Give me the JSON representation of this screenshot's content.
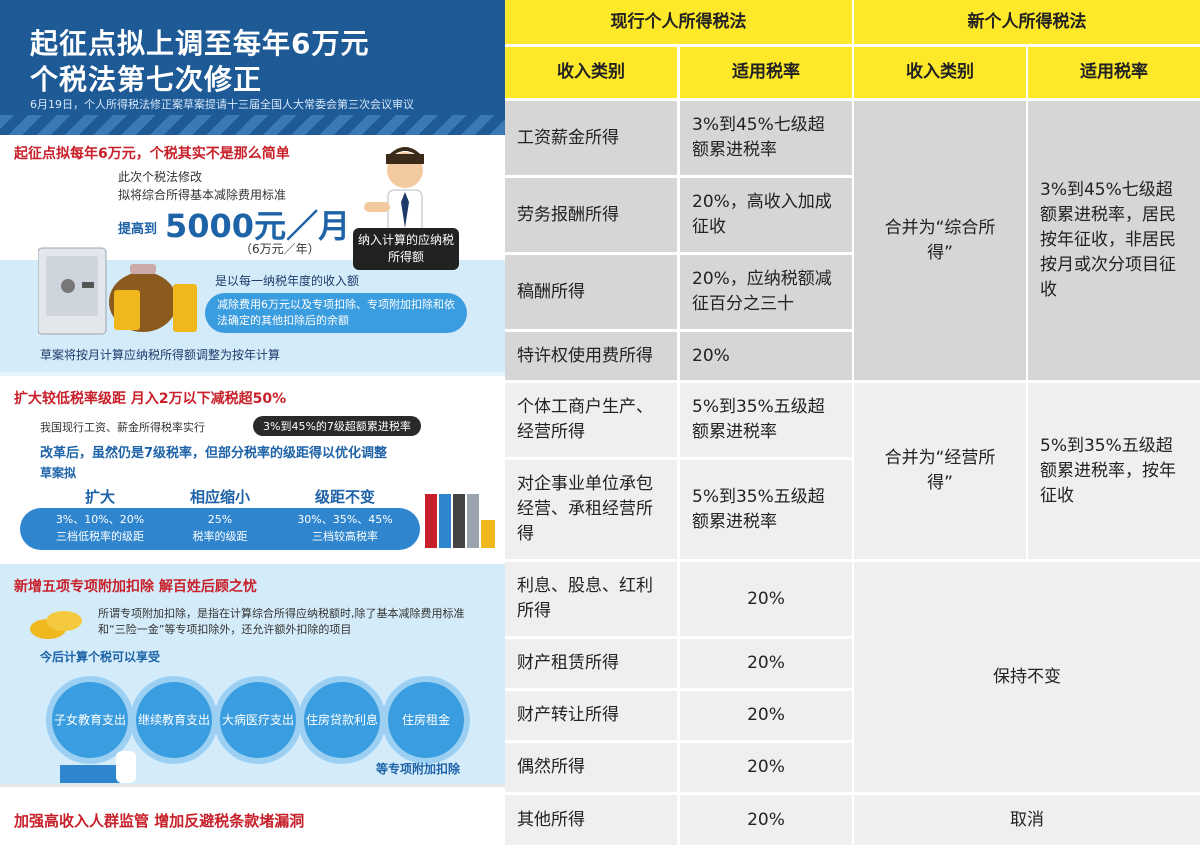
{
  "infographic": {
    "title_line1": "起征点拟上调至每年6万元",
    "title_line2": "个税法第七次修正",
    "subtitle": "6月19日，个人所得税法修正案草案提请十三届全国人大常委会第三次会议审议",
    "section1": {
      "heading": "起征点拟每年6万元，个税其实不是那么简单",
      "line1": "此次个税法修改",
      "line2": "拟将综合所得基本减除费用标准",
      "raise_label": "提高到",
      "amount": "5000元／月",
      "annual": "（6万元／年）",
      "bubble": "纳入计算的应纳税所得额",
      "desc_title": "是以每一纳税年度的收入额",
      "desc_pill": "减除费用6万元以及专项扣除、专项附加扣除和依法确定的其他扣除后的余额",
      "footer": "草案将按月计算应纳税所得额调整为按年计算"
    },
    "section2": {
      "heading": "扩大较低税率级距  月入2万以下减税超50%",
      "line1": "我国现行工资、薪金所得税率实行",
      "highlight": "3%到45%的7级超额累进税率",
      "line2": "改革后，虽然仍是7级税率，但部分税率的级距得以优化调整",
      "draft_label": "草案拟",
      "columns": [
        {
          "label": "扩大",
          "value1": "3%、10%、20%",
          "value2": "三档低税率的级距"
        },
        {
          "label": "相应缩小",
          "value1": "25%",
          "value2": "税率的级距"
        },
        {
          "label": "级距不变",
          "value1": "30%、35%、45%",
          "value2": "三档较高税率"
        }
      ]
    },
    "section3": {
      "heading": "新增五项专项附加扣除  解百姓后顾之忧",
      "desc": "所谓专项附加扣除，是指在计算综合所得应纳税额时,除了基本减除费用标准和“三险一金”等专项扣除外，还允许额外扣除的项目",
      "sub": "今后计算个税可以享受",
      "items": [
        "子女教育支出",
        "继续教育支出",
        "大病医疗支出",
        "住房贷款利息",
        "住房租金"
      ],
      "footer": "等专项附加扣除"
    },
    "section4": {
      "heading": "加强高收入人群监管  增加反避税条款堵漏洞"
    }
  },
  "table": {
    "header_current": "现行个人所得税法",
    "header_new": "新个人所得税法",
    "col_income_type": "收入类别",
    "col_rate": "适用税率",
    "rows": [
      {
        "type": "工资薪金所得",
        "rate": "3%到45%七级超额累进税率"
      },
      {
        "type": "劳务报酬所得",
        "rate": "20%，高收入加成征收"
      },
      {
        "type": "稿酬所得",
        "rate": "20%，应纳税额减征百分之三十"
      },
      {
        "type": "特许权使用费所得",
        "rate": "20%"
      },
      {
        "type": "个体工商户生产、经营所得",
        "rate": "5%到35%五级超额累进税率"
      },
      {
        "type": "对企事业单位承包经营、承租经营所得",
        "rate": "5%到35%五级超额累进税率"
      },
      {
        "type": "利息、股息、红利所得",
        "rate": "20%"
      },
      {
        "type": "财产租赁所得",
        "rate": "20%"
      },
      {
        "type": "财产转让所得",
        "rate": "20%"
      },
      {
        "type": "偶然所得",
        "rate": "20%"
      },
      {
        "type": "其他所得",
        "rate": "20%"
      }
    ],
    "new_groups": [
      {
        "type": "合并为“综合所得”",
        "rate": "3%到45%七级超额累进税率，居民按年征收，非居民按月或次分项目征收"
      },
      {
        "type": "合并为“经营所得”",
        "rate": "5%到35%五级超额累进税率，按年征收"
      },
      {
        "type": "保持不变"
      },
      {
        "type": "取消"
      }
    ]
  }
}
